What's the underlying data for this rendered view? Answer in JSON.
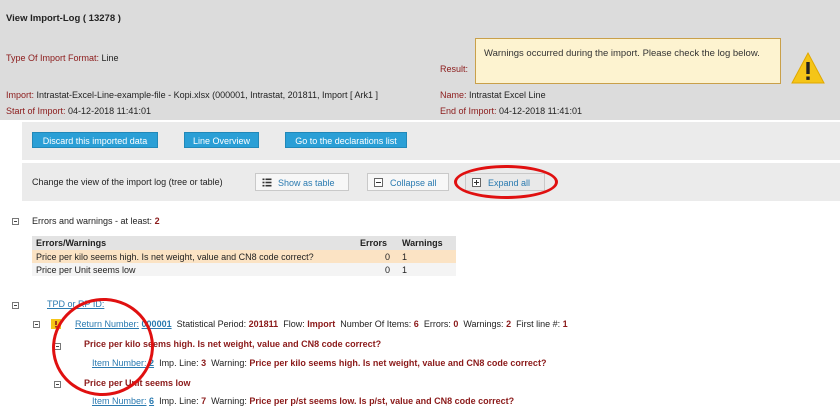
{
  "header": {
    "title": "View Import-Log ( 13278 )",
    "type_label": "Type Of Import Format:",
    "type_value": "Line",
    "result_label": "Result:",
    "warning_message": "Warnings occurred during the import. Please check the log below.",
    "import_label": "Import:",
    "import_value": "Intrastat-Excel-Line-example-file - Kopi.xlsx (000001, Intrastat, 201811, Import [ Ark1 ]",
    "name_label": "Name:",
    "name_value": "Intrastat Excel Line",
    "start_label": "Start of Import:",
    "start_value": "04-12-2018 11:41:01",
    "end_label": "End of Import:",
    "end_value": "04-12-2018 11:41:01"
  },
  "actions": {
    "discard": "Discard this imported data",
    "line_overview": "Line Overview",
    "declarations": "Go to the declarations list"
  },
  "view": {
    "label": "Change the view of the import log (tree or table)",
    "show_as_table": "Show as table",
    "collapse_all": "Collapse all",
    "expand_all": "Expand all"
  },
  "errors_section": {
    "title": "Errors and warnings - at least:",
    "count": "2",
    "col_name": "Errors/Warnings",
    "col_errors": "Errors",
    "col_warnings": "Warnings",
    "rows": [
      {
        "text": "Price per kilo seems high. Is net weight, value and CN8 code correct?",
        "errors": "0",
        "warnings": "1"
      },
      {
        "text": "Price per Unit seems low",
        "errors": "0",
        "warnings": "1"
      }
    ]
  },
  "tree": {
    "tpd_label": "TPD or RP ID:",
    "return_number_label": "Return Number:",
    "return_number_value": "000001",
    "stat_period_label": "Statistical Period:",
    "stat_period_value": "201811",
    "flow_label": "Flow:",
    "flow_value": "Import",
    "items_label": "Number Of Items:",
    "items_value": "6",
    "errors_label": "Errors:",
    "errors_value": "0",
    "warnings_label": "Warnings:",
    "warnings_value": "2",
    "first_line_label": "First line #:",
    "first_line_value": "1",
    "groups": [
      {
        "title": "Price per kilo seems high. Is net weight, value and CN8 code correct?",
        "item_label": "Item Number:",
        "item_value": "2",
        "imp_line_label": "Imp. Line:",
        "imp_line_value": "3",
        "warning_label": "Warning:",
        "warning_value": "Price per kilo seems high. Is net weight, value and CN8 code correct?"
      },
      {
        "title": "Price per Unit seems low",
        "item_label": "Item Number:",
        "item_value": "6",
        "imp_line_label": "Imp. Line:",
        "imp_line_value": "7",
        "warning_label": "Warning:",
        "warning_value": "Price per p/st seems low. Is p/st, value and CN8 code correct?"
      }
    ]
  },
  "colors": {
    "header_bg": "#dcdcdc",
    "maroon_text": "#8b1a1a",
    "button_blue": "#2a9fd6",
    "highlight_ellipse": "#e01010",
    "warning_yellow": "#f5c518"
  },
  "icons": [
    "warning-triangle-icon",
    "table-list-icon",
    "collapse-icon",
    "expand-icon",
    "tree-toggle-icon",
    "warning-small-icon"
  ]
}
